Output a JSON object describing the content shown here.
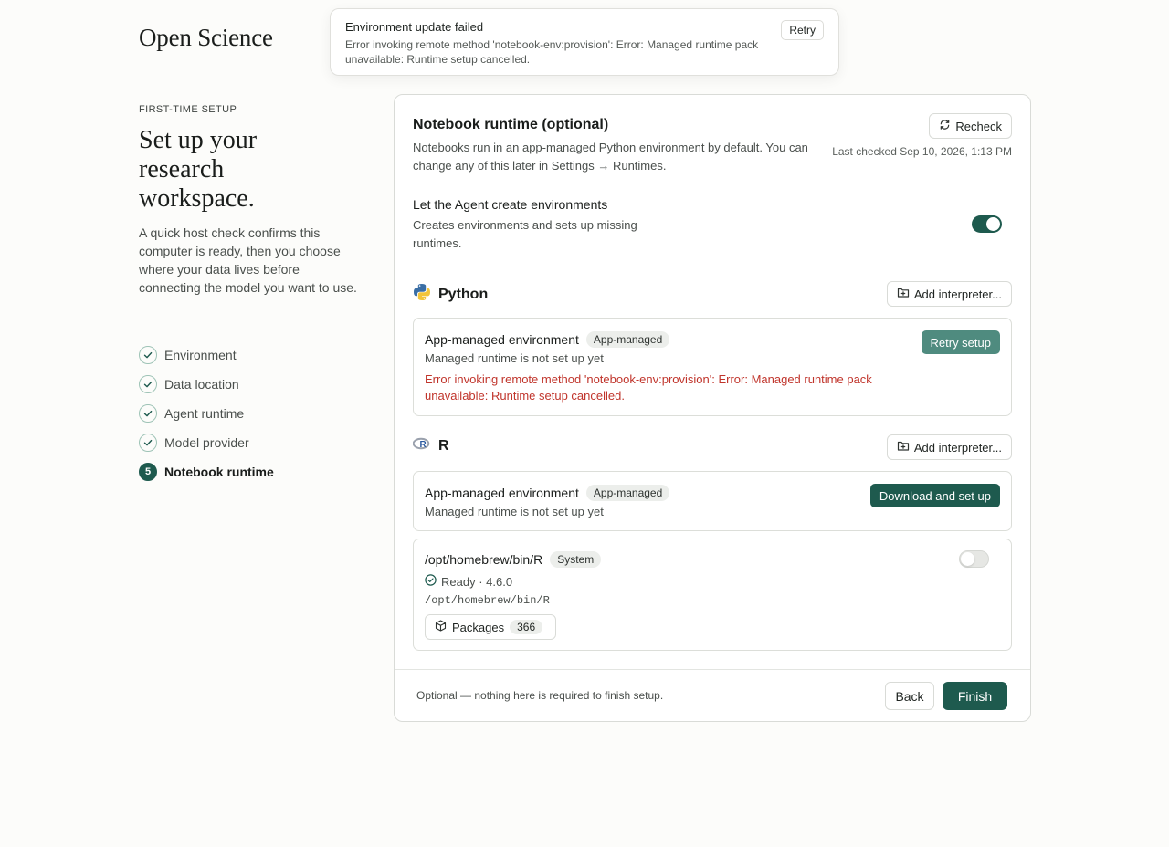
{
  "app": {
    "logo": "Open Science"
  },
  "toast": {
    "title": "Environment update failed",
    "message": "Error invoking remote method 'notebook-env:provision': Error: Managed runtime pack unavailable: Runtime setup cancelled.",
    "retry_label": "Retry"
  },
  "sidebar": {
    "eyebrow": "FIRST-TIME SETUP",
    "headline": "Set up your research workspace.",
    "intro": "A quick host check confirms this computer is ready, then you choose where your data lives before connecting the model you want to use.",
    "steps": [
      {
        "label": "Environment",
        "state": "done"
      },
      {
        "label": "Data location",
        "state": "done"
      },
      {
        "label": "Agent runtime",
        "state": "done"
      },
      {
        "label": "Model provider",
        "state": "done"
      },
      {
        "label": "Notebook runtime",
        "state": "current",
        "number": "5"
      }
    ]
  },
  "card": {
    "title": "Notebook runtime (optional)",
    "description": "Notebooks run in an app-managed Python environment by default. You can change any of this later in Settings → Runtimes.",
    "recheck_label": "Recheck",
    "last_checked": "Last checked Sep 10, 2026, 1:13 PM",
    "agent": {
      "title": "Let the Agent create environments",
      "description": "Creates environments and sets up missing runtimes.",
      "enabled": true
    },
    "python": {
      "name": "Python",
      "add_label": "Add interpreter...",
      "env": {
        "name": "App-managed environment",
        "badge": "App-managed",
        "status": "Managed runtime is not set up yet",
        "error": "Error invoking remote method 'notebook-env:provision': Error: Managed runtime pack unavailable: Runtime setup cancelled.",
        "action_label": "Retry setup"
      }
    },
    "r": {
      "name": "R",
      "add_label": "Add interpreter...",
      "env": {
        "name": "App-managed environment",
        "badge": "App-managed",
        "status": "Managed runtime is not set up yet",
        "action_label": "Download and set up"
      },
      "system": {
        "name": "/opt/homebrew/bin/R",
        "badge": "System",
        "status": "Ready · 4.6.0",
        "path": "/opt/homebrew/bin/R",
        "packages_label": "Packages",
        "packages_count": "366",
        "enabled": false
      }
    },
    "footer": {
      "note": "Optional — nothing here is required to finish setup.",
      "back_label": "Back",
      "finish_label": "Finish"
    }
  },
  "colors": {
    "accent": "#1e5a4e",
    "error": "#c0342b",
    "background": "#fcfcfa"
  }
}
